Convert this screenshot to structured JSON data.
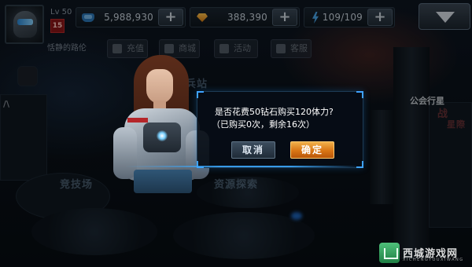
{
  "player": {
    "level": "Lv 50",
    "vip": "15",
    "name": "恬静的路伦"
  },
  "resources": {
    "coins": "5,988,930",
    "gems": "388,390",
    "energy": "109/109",
    "plus": "+"
  },
  "sub_menu": [
    "充值",
    "商城",
    "活动",
    "客服"
  ],
  "scene_labels": {
    "top_center": "佣兵站",
    "left_bottom": "竞技场",
    "center_bottom": "资源探索",
    "right_side": [
      "公会行星",
      "战",
      "星際"
    ],
    "left_side": "/\\"
  },
  "dialog": {
    "line1": "是否花费50钻石购买120体力?",
    "line2": "（已购买0次，剩余16次）",
    "cancel": "取消",
    "confirm": "确定"
  },
  "watermark": {
    "text": "西城游戏网",
    "sub": "XICHENGYOUXIWANG"
  },
  "colors": {
    "accent_blue": "#3fa3ff",
    "confirm_orange": "#d97515",
    "vip_red": "#8a1518"
  }
}
